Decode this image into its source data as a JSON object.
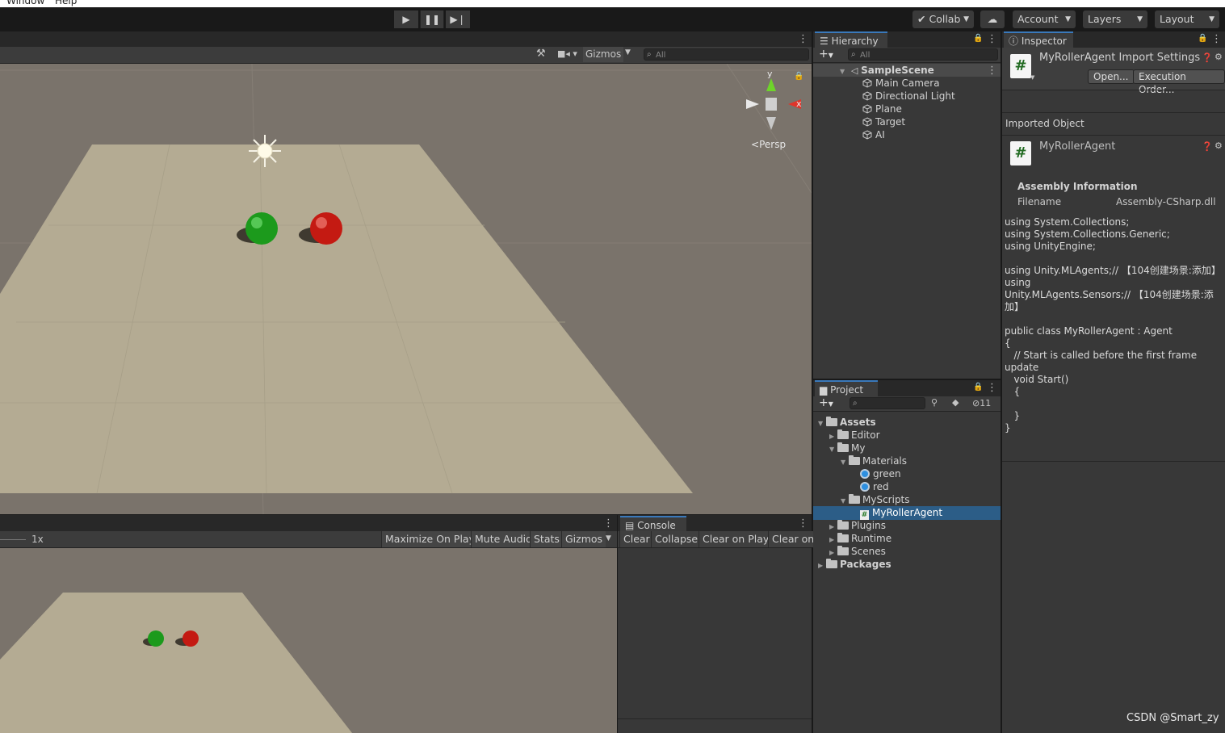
{
  "menubar": {
    "items": [
      "Window",
      "Help"
    ]
  },
  "toolbar": {
    "collab": "Collab",
    "account": "Account",
    "layers": "Layers",
    "layout": "Layout"
  },
  "scene_view": {
    "gizmos": "Gizmos",
    "search_placeholder": "All",
    "axis_y": "y",
    "axis_x": "x",
    "projection": "Persp"
  },
  "game_view": {
    "scale": "1x",
    "toggles": [
      "Maximize On Play",
      "Mute Audio",
      "Stats",
      "Gizmos"
    ]
  },
  "console": {
    "tab": "Console",
    "buttons": [
      "Clear",
      "Collapse",
      "Clear on Play",
      "Clear on"
    ]
  },
  "hierarchy": {
    "tab": "Hierarchy",
    "search_placeholder": "All",
    "scene": "SampleScene",
    "objects": [
      "Main Camera",
      "Directional Light",
      "Plane",
      "Target",
      "AI"
    ]
  },
  "project": {
    "tab": "Project",
    "hidden_count": "11",
    "tree": [
      {
        "label": "Assets",
        "depth": 0,
        "open": true,
        "bold": true,
        "icon": "folder"
      },
      {
        "label": "Editor",
        "depth": 1,
        "open": false,
        "icon": "folder"
      },
      {
        "label": "My",
        "depth": 1,
        "open": true,
        "icon": "folder"
      },
      {
        "label": "Materials",
        "depth": 2,
        "open": true,
        "icon": "folder"
      },
      {
        "label": "green",
        "depth": 3,
        "icon": "material"
      },
      {
        "label": "red",
        "depth": 3,
        "icon": "material"
      },
      {
        "label": "MyScripts",
        "depth": 2,
        "open": true,
        "icon": "folder"
      },
      {
        "label": "MyRollerAgent",
        "depth": 3,
        "icon": "script",
        "selected": true
      },
      {
        "label": "Plugins",
        "depth": 1,
        "open": false,
        "icon": "folder"
      },
      {
        "label": "Runtime",
        "depth": 1,
        "open": false,
        "icon": "folder"
      },
      {
        "label": "Scenes",
        "depth": 1,
        "open": false,
        "icon": "folder"
      },
      {
        "label": "Packages",
        "depth": 0,
        "open": false,
        "bold": true,
        "icon": "folder"
      }
    ]
  },
  "inspector": {
    "tab": "Inspector",
    "title": "MyRollerAgent Import Settings",
    "open_btn": "Open...",
    "exec_btn": "Execution Order...",
    "imported_object": "Imported Object",
    "object_name": "MyRollerAgent",
    "assembly_info": "Assembly Information",
    "filename_label": "Filename",
    "filename_value": "Assembly-CSharp.dll",
    "code": "using System.Collections;\nusing System.Collections.Generic;\nusing UnityEngine;\n\nusing Unity.MLAgents;// 【104创建场景:添加】\nusing\nUnity.MLAgents.Sensors;// 【104创建场景:添加】\n\npublic class MyRollerAgent : Agent\n{\n   // Start is called before the first frame update\n   void Start()\n   {\n\n   }\n}"
  },
  "watermark": "CSDN @Smart_zy",
  "colors": {
    "accent": "#3a79bb",
    "selected_row": "#2c5d87",
    "ground": "#b4ab93",
    "sky": "#7a736b"
  }
}
